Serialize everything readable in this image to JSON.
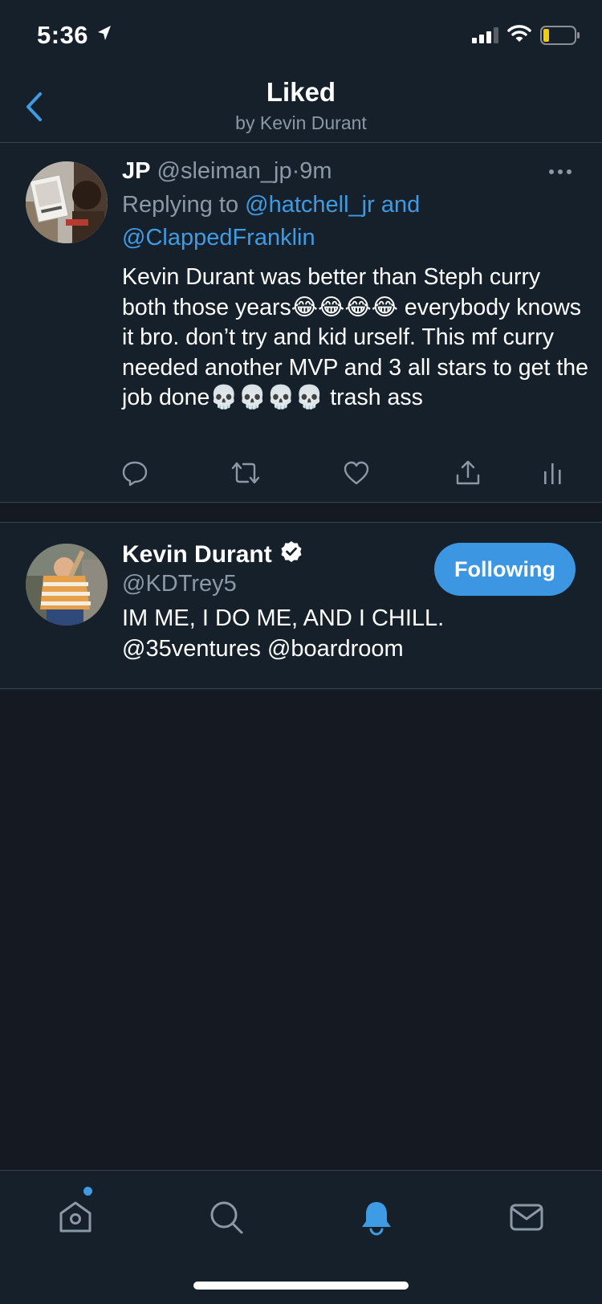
{
  "status_bar": {
    "time": "5:36",
    "icons": [
      "location-arrow-icon",
      "cellular-signal-icon",
      "wifi-icon",
      "battery-icon"
    ]
  },
  "header": {
    "title": "Liked",
    "subtitle": "by Kevin Durant"
  },
  "tweet": {
    "name": "JP",
    "handle": "@sleiman_jp",
    "separator": "·",
    "time": "9m",
    "replying_label": "Replying to",
    "replying_user_1": "@hatchell_jr",
    "replying_and": "and",
    "replying_user_2": "@ClappedFranklin",
    "body": "Kevin Durant was better than Steph curry both those years😂😂😂😂 everybody knows it bro. don’t try and kid urself. This mf curry needed another MVP and 3 all stars to get the job done💀💀💀💀 trash ass",
    "actions": [
      "reply-icon",
      "retweet-icon",
      "like-icon",
      "share-icon",
      "analytics-icon"
    ]
  },
  "user": {
    "name": "Kevin Durant",
    "handle": "@KDTrey5",
    "bio": "IM ME, I DO ME, AND I CHILL. @35ventures @boardroom",
    "follow_label": "Following",
    "verified": true
  },
  "tab_bar": {
    "tabs": [
      "home-icon",
      "search-icon",
      "notifications-icon",
      "messages-icon"
    ],
    "active": "notifications-icon",
    "home_has_badge": true
  },
  "colors": {
    "background": "#15202b",
    "accent": "#3e9be4",
    "secondary_text": "#8b98a5",
    "divider": "#38444d"
  }
}
